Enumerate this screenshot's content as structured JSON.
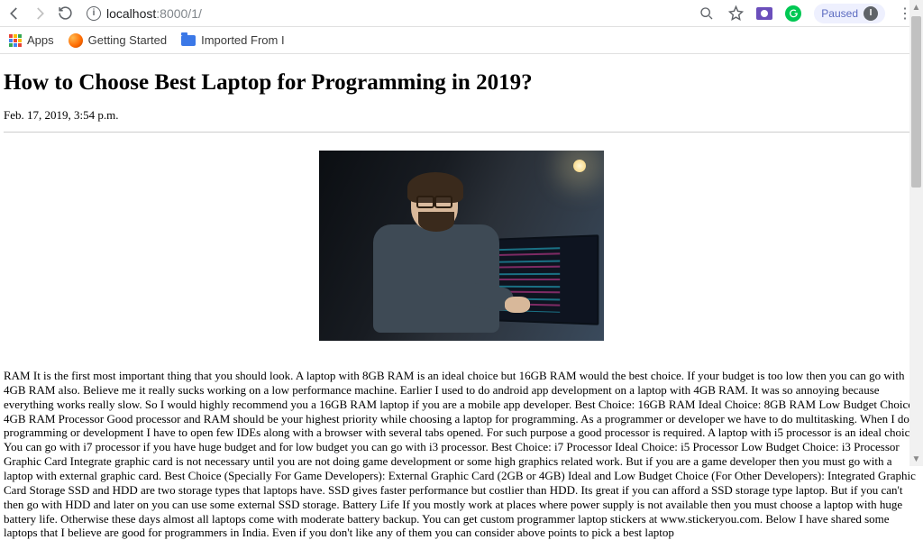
{
  "toolbar": {
    "url_prefix": "localhost",
    "url_suffix": ":8000/1/",
    "paused_label": "Paused",
    "avatar_initial": "I"
  },
  "bookmarks": {
    "apps": "Apps",
    "getting_started": "Getting Started",
    "imported": "Imported From I"
  },
  "article": {
    "title": "How to Choose Best Laptop for Programming in 2019?",
    "date": "Feb. 17, 2019, 3:54 p.m.",
    "body": "RAM It is the first most important thing that you should look. A laptop with 8GB RAM is an ideal choice but 16GB RAM would the best choice. If your budget is too low then you can go with 4GB RAM also. Believe me it really sucks working on a low performance machine. Earlier I used to do android app development on a laptop with 4GB RAM. It was so annoying because everything works really slow. So I would highly recommend you a 16GB RAM laptop if you are a mobile app developer. Best Choice: 16GB RAM Ideal Choice: 8GB RAM Low Budget Choice: 4GB RAM Processor Good processor and RAM should be your highest priority while choosing a laptop for programming. As a programmer or developer we have to do multitasking. When I do programming or development I have to open few IDEs along with a browser with several tabs opened. For such purpose a good processor is required. A laptop with i5 processor is an ideal choice. You can go with i7 processor if you have huge budget and for low budget you can go with i3 processor. Best Choice: i7 Processor Ideal Choice: i5 Processor Low Budget Choice: i3 Processor Graphic Card Integrate graphic card is not necessary until you are not doing game development or some high graphics related work. But if you are a game developer then you must go with a laptop with external graphic card. Best Choice (Specially For Game Developers): External Graphic Card (2GB or 4GB) Ideal and Low Budget Choice (For Other Developers): Integrated Graphic Card Storage SSD and HDD are two storage types that laptops have. SSD gives faster performance but costlier than HDD. Its great if you can afford a SSD storage type laptop. But if you can't then go with HDD and later on you can use some external SSD storage. Battery Life If you mostly work at places where power supply is not available then you must choose a laptop with huge battery life. Otherwise these days almost all laptops come with moderate battery backup. You can get custom programmer laptop stickers at www.stickeryou.com. Below I have shared some laptops that I believe are good for programmers in India. Even if you don't like any of them you can consider above points to pick a best laptop"
  }
}
